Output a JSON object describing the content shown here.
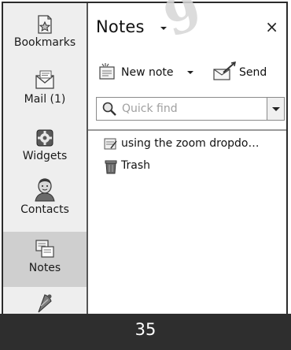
{
  "sidebar": {
    "items": [
      {
        "label": "Bookmarks",
        "icon": "bookmarks-icon",
        "active": false
      },
      {
        "label": "Mail (1)",
        "icon": "mail-icon",
        "active": false
      },
      {
        "label": "Widgets",
        "icon": "widgets-icon",
        "active": false
      },
      {
        "label": "Contacts",
        "icon": "contacts-icon",
        "active": false
      },
      {
        "label": "Notes",
        "icon": "notes-icon",
        "active": true
      },
      {
        "label": "",
        "icon": "feed-icon",
        "active": false
      }
    ]
  },
  "panel": {
    "title": "Notes",
    "close_glyph": "×",
    "toolbar": {
      "new_note_label": "New note",
      "send_label": "Send"
    },
    "search": {
      "placeholder": "Quick find"
    },
    "list": [
      {
        "label": "using the zoom dropdo…",
        "icon": "note-icon"
      },
      {
        "label": "Trash",
        "icon": "trash-icon"
      }
    ]
  },
  "footer": {
    "page_number": "35"
  },
  "watermark": {
    "text": "9"
  },
  "colors": {
    "sidebar_bg": "#eeeeee",
    "active_item_bg": "#cfcfcf",
    "footer_bg": "#2e2e2e",
    "footer_text": "#ffffff"
  }
}
